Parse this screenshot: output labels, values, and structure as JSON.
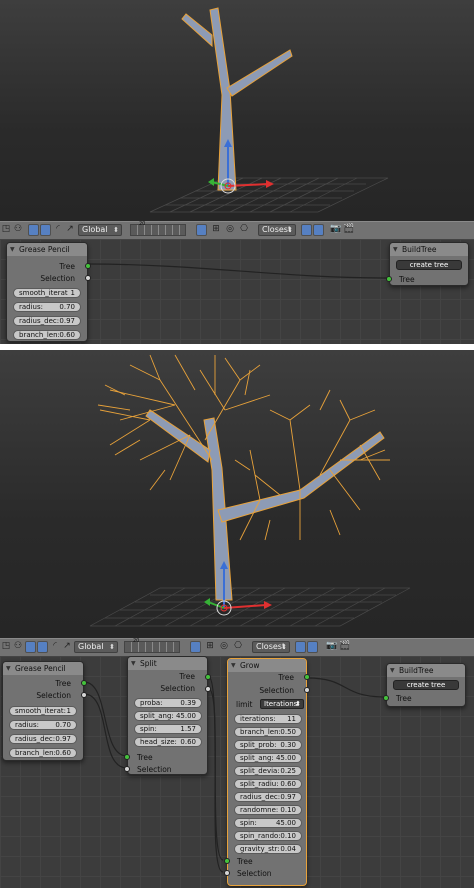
{
  "panel_top": {
    "header": {
      "orientation_dropdown": "Global",
      "snap_dropdown": "Closest",
      "layer_number": "20"
    },
    "nodes": {
      "grease_pencil": {
        "title": "Grease Pencil",
        "outputs": [
          "Tree",
          "Selection"
        ],
        "fields": [
          {
            "label": "smooth_iterat",
            "value": "1"
          },
          {
            "label": "radius:",
            "value": "0.70"
          },
          {
            "label": "radius_dec:",
            "value": "0.97"
          },
          {
            "label": "branch_len:",
            "value": "0.60"
          }
        ]
      },
      "build_tree": {
        "title": "BuildTree",
        "button": "create tree",
        "input": "Tree"
      }
    }
  },
  "panel_bottom": {
    "header": {
      "orientation_dropdown": "Global",
      "snap_dropdown": "Closest",
      "layer_number": "20"
    },
    "nodes": {
      "grease_pencil": {
        "title": "Grease Pencil",
        "outputs": [
          "Tree",
          "Selection"
        ],
        "fields": [
          {
            "label": "smooth_iterat:",
            "value": "1"
          },
          {
            "label": "radius:",
            "value": "0.70"
          },
          {
            "label": "radius_dec:",
            "value": "0.97"
          },
          {
            "label": "branch_len:",
            "value": "0.60"
          }
        ]
      },
      "split": {
        "title": "Split",
        "outputs": [
          "Tree",
          "Selection"
        ],
        "fields": [
          {
            "label": "proba:",
            "value": "0.39"
          },
          {
            "label": "split_ang:",
            "value": "45.00"
          },
          {
            "label": "spin:",
            "value": "1.57"
          },
          {
            "label": "head_size:",
            "value": "0.60"
          }
        ],
        "inputs": [
          "Tree",
          "Selection"
        ]
      },
      "grow": {
        "title": "Grow",
        "outputs": [
          "Tree",
          "Selection"
        ],
        "limit_label": "limit",
        "limit_value": "Iterations",
        "fields": [
          {
            "label": "iterations:",
            "value": "11"
          },
          {
            "label": "branch_len:",
            "value": "0.50"
          },
          {
            "label": "split_prob:",
            "value": "0.30"
          },
          {
            "label": "split_ang:",
            "value": "45.00"
          },
          {
            "label": "split_devia:",
            "value": "0.25"
          },
          {
            "label": "split_radiu:",
            "value": "0.60"
          },
          {
            "label": "radius_dec:",
            "value": "0.97"
          },
          {
            "label": "randomne:",
            "value": "0.10"
          },
          {
            "label": "spin:",
            "value": "45.00"
          },
          {
            "label": "spin_rando:",
            "value": "0.10"
          },
          {
            "label": "gravity_str:",
            "value": "0.04"
          }
        ],
        "inputs": [
          "Tree",
          "Selection"
        ]
      },
      "build_tree": {
        "title": "BuildTree",
        "button": "create tree",
        "input": "Tree"
      }
    }
  },
  "colors": {
    "viewport_bg": "#2e2e2e",
    "node_bg": "#727272",
    "selected_outline": "#e8a23a",
    "socket_green": "#44c23c",
    "socket_white": "#d6d6d6",
    "active_header_button": "#5680c2"
  },
  "icons": [
    "view-icon",
    "snap-icon",
    "manipulator-icon",
    "layer-grid-icon",
    "proportional-edit-icon",
    "render-icon"
  ]
}
